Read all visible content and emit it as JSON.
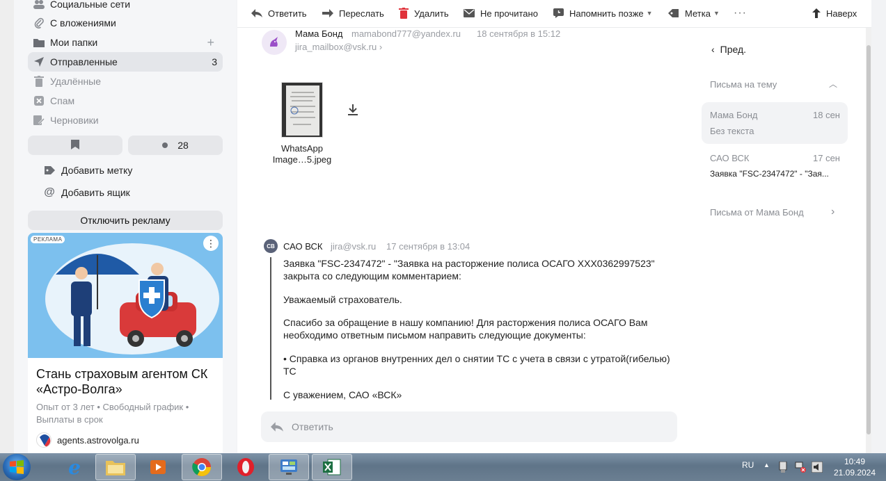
{
  "sidebar": {
    "items": [
      {
        "label": "Социальные сети"
      },
      {
        "label": "С вложениями"
      },
      {
        "label": "Мои папки"
      },
      {
        "label": "Отправленные",
        "count": "3"
      },
      {
        "label": "Удалённые"
      },
      {
        "label": "Спам"
      },
      {
        "label": "Черновики"
      }
    ],
    "unread_count": "28",
    "add_label": "Добавить метку",
    "add_mailbox": "Добавить ящик"
  },
  "ad": {
    "disable_label": "Отключить рекламу",
    "badge": "РЕКЛАМА",
    "title": "Стань страховым агентом СК «Астро-Волга»",
    "meta": "Опыт от 3 лет • Свободный график • Выплаты в срок",
    "domain": "agents.astrovolga.ru"
  },
  "toolbar": {
    "reply": "Ответить",
    "forward": "Переслать",
    "delete": "Удалить",
    "unread": "Не прочитано",
    "remind": "Напомнить позже",
    "label": "Метка",
    "up": "Наверх"
  },
  "message1": {
    "sender": "Мама Бонд",
    "email": "mamabond777@yandex.ru",
    "date": "18 сентября в 15:12",
    "to": "jira_mailbox@vsk.ru",
    "attachment_line1": "WhatsApp",
    "attachment_line2": "Image…5.jpeg"
  },
  "message2": {
    "avatar": "СВ",
    "sender": "САО ВСК",
    "email": "jira@vsk.ru",
    "date": "17 сентября в 13:04",
    "p1": "Заявка \"FSC-2347472\" - \"Заявка на расторжение полиса ОСАГО XXX0362997523\" закрыта со следующим комментарием:",
    "p2": "Уважаемый страхователь.",
    "p3": "Спасибо за обращение в нашу компанию! Для расторжения полиса ОСАГО Вам необходимо ответным письмом направить следующие документы:",
    "p4": "• Справка из органов внутренних дел о снятии ТС с учета в связи с утратой(гибелью) ТС",
    "p5": "С уважением, САО «ВСК»"
  },
  "reply_box": "Ответить",
  "right_panel": {
    "prev": "Пред.",
    "thread_title": "Письма на тему",
    "thread": [
      {
        "sender": "Мама Бонд",
        "date": "18 сен",
        "snippet": "Без текста"
      },
      {
        "sender": "САО ВСК",
        "date": "17 сен",
        "snippet": "Заявка \"FSC-2347472\" - \"Зая..."
      }
    ],
    "from_sender": "Письма от Мама Бонд"
  },
  "taskbar": {
    "lang": "RU",
    "time": "10:49",
    "date": "21.09.2024"
  },
  "colors": {
    "accent_red": "#e0333b",
    "active_bg": "#e4e6ea",
    "avatar_sv": "#5a6278"
  }
}
